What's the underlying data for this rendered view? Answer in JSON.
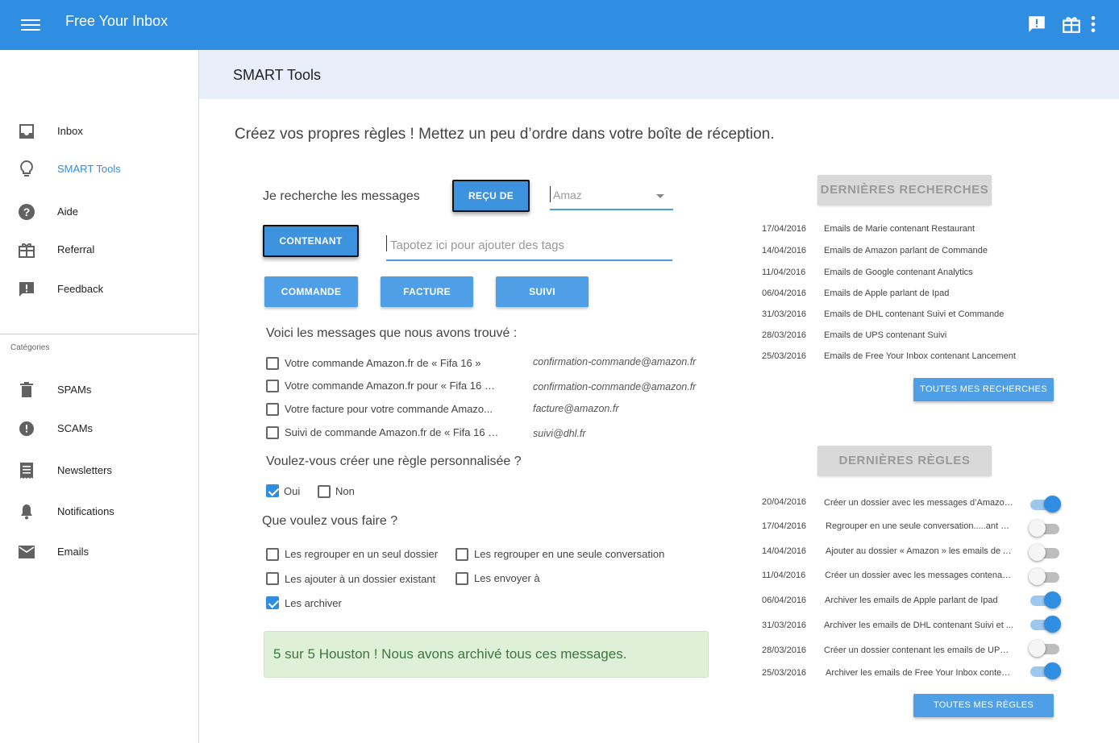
{
  "app": {
    "title": "Free Your Inbox"
  },
  "sidebar": {
    "items": [
      {
        "label": "Inbox",
        "icon": "inbox-icon"
      },
      {
        "label": "SMART Tools",
        "icon": "lightbulb-icon",
        "active": true
      },
      {
        "label": "Aide",
        "icon": "help-icon"
      },
      {
        "label": "Referral",
        "icon": "gift-icon"
      },
      {
        "label": "Feedback",
        "icon": "feedback-icon"
      }
    ],
    "categories_title": "Catégories",
    "categories": [
      {
        "label": "SPAMs",
        "icon": "trash-icon"
      },
      {
        "label": "SCAMs",
        "icon": "alert-icon"
      },
      {
        "label": "Newsletters",
        "icon": "newsletter-icon"
      },
      {
        "label": "Notifications",
        "icon": "bell-icon"
      },
      {
        "label": "Emails",
        "icon": "mail-icon"
      }
    ]
  },
  "page": {
    "title": "SMART Tools",
    "headline": "Créez vos propres règles ! Mettez un peu d’ordre dans votre boîte de réception."
  },
  "search": {
    "label": "Je recherche les messages",
    "from_button": "REÇU DE",
    "from_value": "Amaz",
    "contains_button": "CONTENANT",
    "tags_placeholder": "Tapotez ici pour ajouter des tags",
    "tags": [
      "COMMANDE",
      "FACTURE",
      "SUIVI"
    ]
  },
  "results": {
    "title": "Voici les messages que nous avons trouvé :",
    "messages": [
      {
        "subject": "Votre commande Amazon.fr de « Fifa 16 »",
        "sender": "confirmation-commande@amazon.fr",
        "checked": false
      },
      {
        "subject": "Votre commande Amazon.fr pour « Fifa 16 »...",
        "sender": "confirmation-commande@amazon.fr",
        "checked": false
      },
      {
        "subject": "Votre  facture pour votre commande Amazo...",
        "sender": "facture@amazon.fr",
        "checked": false
      },
      {
        "subject": "Suivi de commande Amazon.fr de « Fifa 16 »...",
        "sender": "suivi@dhl.fr",
        "checked": false
      }
    ]
  },
  "custom_rule": {
    "question": "Voulez-vous créer une règle personnalisée ?",
    "yes": "Oui",
    "no": "Non",
    "yes_checked": true,
    "no_checked": false
  },
  "actions": {
    "question": "Que voulez vous faire ?",
    "options": [
      {
        "label": "Les regrouper en un seul dossier",
        "checked": false
      },
      {
        "label": "Les regrouper en une seule conversation",
        "checked": false
      },
      {
        "label": "Les ajouter à un dossier existant",
        "checked": false
      },
      {
        "label": "Les envoyer à",
        "checked": false
      },
      {
        "label": "Les archiver",
        "checked": true
      }
    ]
  },
  "alert": {
    "message": "5 sur 5 Houston ! Nous avons archivé tous ces messages."
  },
  "recent_searches": {
    "title": "DERNIÈRES RECHERCHES",
    "rows": [
      {
        "date": "17/04/2016",
        "text": "Emails de Marie contenant Restaurant"
      },
      {
        "date": "14/04/2016",
        "text": "Emails de Amazon parlant de Commande"
      },
      {
        "date": "11/04/2016",
        "text": "Emails de Google contenant Analytics"
      },
      {
        "date": "06/04/2016",
        "text": "Emails de Apple parlant de Ipad"
      },
      {
        "date": "31/03/2016",
        "text": "Emails de DHL contenant Suivi et Commande"
      },
      {
        "date": "28/03/2016",
        "text": "Emails de UPS contenant Suivi"
      },
      {
        "date": "25/03/2016",
        "text": "Emails de Free Your Inbox contenant Lancement"
      }
    ],
    "button": "TOUTES MES RECHERCHES"
  },
  "recent_rules": {
    "title": "DERNIÈRES RÈGLES",
    "rows": [
      {
        "date": "20/04/2016",
        "text": "Créer un dossier avec les messages d’Amazon...",
        "on": true
      },
      {
        "date": "17/04/2016",
        "text": "Regrouper en une seule conversation.....ant Re...",
        "on": false
      },
      {
        "date": "14/04/2016",
        "text": "Ajouter au dossier « Amazon » les emails de A ...",
        "on": false
      },
      {
        "date": "11/04/2016",
        "text": "Créer un dossier avec les messages contenan...",
        "on": false
      },
      {
        "date": "06/04/2016",
        "text": "Archiver les emails de Apple parlant de Ipad",
        "on": true
      },
      {
        "date": "31/03/2016",
        "text": "Archiver les emails de DHL contenant Suivi et ...",
        "on": true
      },
      {
        "date": "28/03/2016",
        "text": "Créer un dossier contenant les emails de UPS ...",
        "on": false
      },
      {
        "date": "25/03/2016",
        "text": "Archiver les emails de Free Your Inbox conten...",
        "on": true
      }
    ],
    "button": "TOUTES MES RÈGLES"
  },
  "colors": {
    "primary": "#2f8ee2",
    "button": "#4e9fe6",
    "subheader": "#e8effa",
    "success_bg": "#dff0d8",
    "success_text": "#3c763d"
  }
}
